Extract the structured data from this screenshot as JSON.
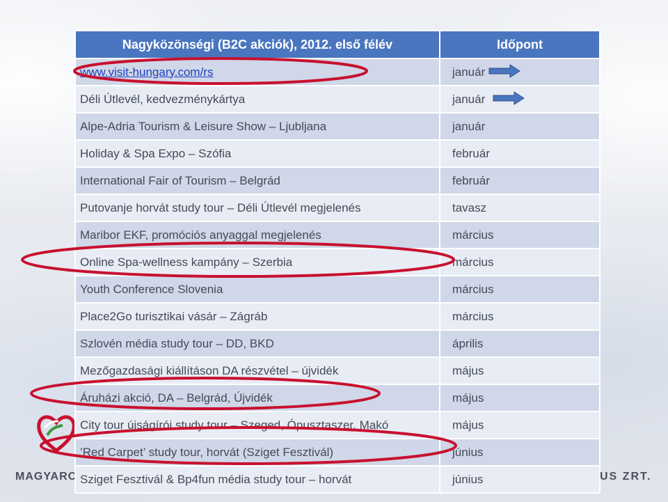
{
  "table": {
    "header": {
      "event": "Nagyközönségi (B2C akciók), 2012. első félév",
      "date": "Időpont"
    },
    "rows": [
      {
        "event": "www.visit-hungary.com/rs",
        "date": "január"
      },
      {
        "event": "Déli Útlevél, kedvezménykártya",
        "date": "január"
      },
      {
        "event": "Alpe-Adria Tourism & Leisure Show – Ljubljana",
        "date": "január"
      },
      {
        "event": "Holiday & Spa Expo – Szófia",
        "date": "február"
      },
      {
        "event": "International Fair of Tourism – Belgrád",
        "date": "február"
      },
      {
        "event": "Putovanje horvát study tour – Déli Útlevél megjelenés",
        "date": "tavasz"
      },
      {
        "event": "Maribor EKF, promóciós anyaggal megjelenés",
        "date": "március"
      },
      {
        "event": "Online Spa-wellness kampány – Szerbia",
        "date": "március"
      },
      {
        "event": "Youth Conference Slovenia",
        "date": "március"
      },
      {
        "event": "Place2Go turisztikai vásár – Zágráb",
        "date": "március"
      },
      {
        "event": "Szlovén média study tour – DD, BKD",
        "date": "április"
      },
      {
        "event": "Mezőgazdasági kiállításon DA részvétel – újvidék",
        "date": "május"
      },
      {
        "event": "Áruházi akció, DA – Belgrád, Újvidék",
        "date": "május"
      },
      {
        "event": "City tour újságírói study tour – Szeged, Ópusztaszer, Makó",
        "date": "május"
      },
      {
        "event": "’Red Carpet’ study tour, horvát (Sziget Fesztivál)",
        "date": "június"
      },
      {
        "event": "Sziget Fesztivál & Bp4fun média study tour – horvát",
        "date": "június"
      }
    ]
  },
  "branding": {
    "left_text": "MAGYAROR",
    "right_text": "US ZRT."
  },
  "colors": {
    "header_bg": "#4a76bf",
    "row_dark": "#cfd7e8",
    "row_light": "#e8ecf4",
    "oval_red": "#c8102e",
    "arrow_blue": "#4a76bf"
  },
  "icons": [
    "right-arrow-icon",
    "heart-logo-icon"
  ]
}
